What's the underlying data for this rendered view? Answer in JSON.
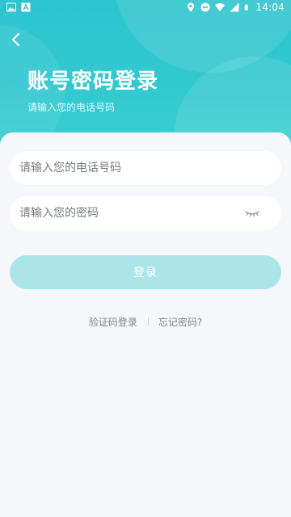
{
  "status_bar": {
    "time": "14:04",
    "icons_left": [
      "image-icon",
      "text-icon"
    ],
    "icons_right": [
      "location-icon",
      "dnd-icon",
      "wifi-icon",
      "signal-icon",
      "battery-icon"
    ]
  },
  "header": {
    "title": "账号密码登录",
    "subtitle": "请输入您的电话号码"
  },
  "form": {
    "phone_placeholder": "请输入您的电话号码",
    "password_placeholder": "请输入您的密码",
    "login_label": "登录"
  },
  "links": {
    "sms_login": "验证码登录",
    "forgot": "忘记密码?"
  },
  "colors": {
    "accent": "#2ec4cf",
    "button_disabled": "#abe5ea",
    "background": "#f6f7fa"
  }
}
